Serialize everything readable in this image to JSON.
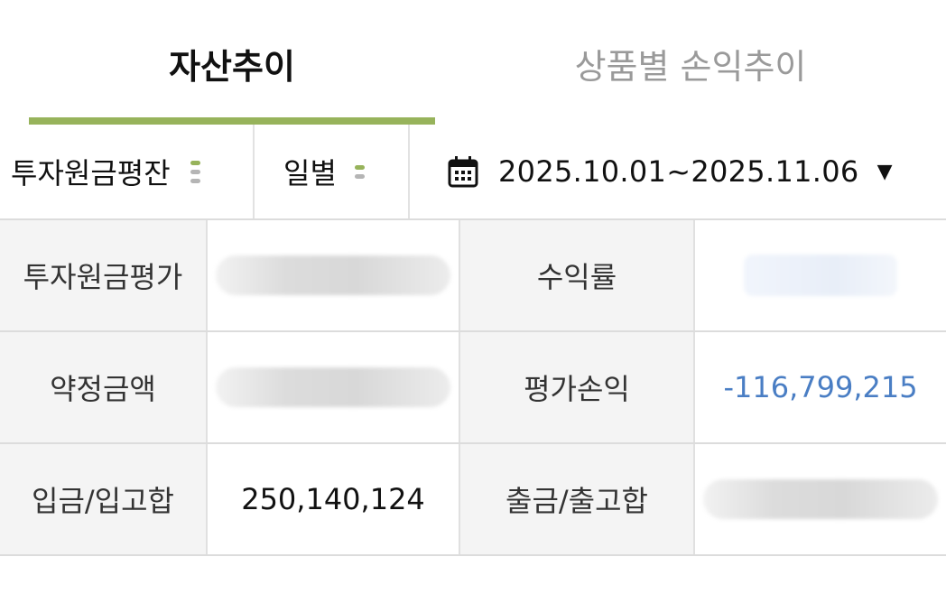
{
  "tabs": [
    {
      "label": "자산추이",
      "active": true
    },
    {
      "label": "상품별 손익추이",
      "active": false
    }
  ],
  "filters": {
    "type_label": "투자원금평잔",
    "period_label": "일별",
    "date_range": "2025.10.01~2025.11.06",
    "calendar_icon": "calendar-icon",
    "caret_icon": "caret-down-icon"
  },
  "summary": {
    "rows": [
      {
        "label_left": "투자원금평가",
        "value_left": "",
        "label_right": "수익률",
        "value_right": ""
      },
      {
        "label_left": "약정금액",
        "value_left": "",
        "label_right": "평가손익",
        "value_right": "-116,799,215"
      },
      {
        "label_left": "입금/입고합",
        "value_left": "250,140,124",
        "label_right": "출금/출고합",
        "value_right": ""
      }
    ]
  },
  "colors": {
    "accent": "#97b35b",
    "negative": "#4a7ec4",
    "label_bg": "#f4f4f4"
  }
}
